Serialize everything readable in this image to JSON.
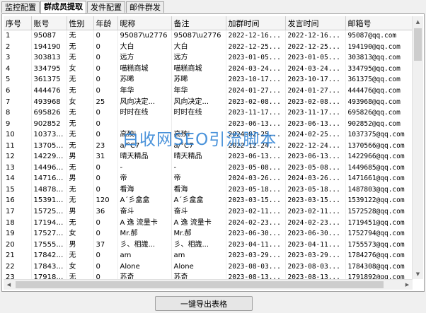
{
  "tabs": [
    "监控配置",
    "群成员提取",
    "发件配置",
    "邮件群发"
  ],
  "active_tab": 1,
  "columns": [
    "序号",
    "账号",
    "性别",
    "年龄",
    "昵称",
    "备注",
    "加群时间",
    "发言时间",
    "邮箱号"
  ],
  "rows": [
    [
      "1",
      "95087",
      "无",
      "0",
      "95087\\u2776",
      "95087\\u2776",
      "2022-12-16...",
      "2022-12-16...",
      "95087@qq.com"
    ],
    [
      "2",
      "194190",
      "无",
      "0",
      "大白",
      "大白",
      "2022-12-25...",
      "2022-12-25...",
      "194190@qq.com"
    ],
    [
      "3",
      "303813",
      "无",
      "0",
      "远方",
      "远方",
      "2023-01-05...",
      "2023-01-05...",
      "303813@qq.com"
    ],
    [
      "4",
      "334795",
      "女",
      "0",
      "喵糕商城",
      "喵糕商城",
      "2024-03-24...",
      "2024-03-24...",
      "334795@qq.com"
    ],
    [
      "5",
      "361375",
      "无",
      "0",
      "苏晞",
      "苏晞",
      "2023-10-17...",
      "2023-10-17...",
      "361375@qq.com"
    ],
    [
      "6",
      "444476",
      "无",
      "0",
      "年华",
      "年华",
      "2024-01-27...",
      "2024-01-27...",
      "444476@qq.com"
    ],
    [
      "7",
      "493968",
      "女",
      "25",
      "风向决定...",
      "风向决定...",
      "2023-02-08...",
      "2023-02-08...",
      "493968@qq.com"
    ],
    [
      "8",
      "695826",
      "无",
      "0",
      "时时在线",
      "时时在线",
      "2023-11-17...",
      "2023-11-17...",
      "695826@qq.com"
    ],
    [
      "9",
      "902852",
      "无",
      "0",
      "",
      "",
      "2023-06-13...",
      "2023-06-13...",
      "902852@qq.com"
    ],
    [
      "10",
      "1037375",
      "无",
      "0",
      "高殃i",
      "高殃i",
      "2024-02-25...",
      "2024-02-25...",
      "1037375@qq.com"
    ],
    [
      "11",
      "1370566",
      "无",
      "23",
      "a/°C7",
      "a/°C7",
      "2022-12-24...",
      "2022-12-24...",
      "1370566@qq.com"
    ],
    [
      "12",
      "1422966",
      "男",
      "31",
      "晴天精品",
      "晴天精品",
      "2023-06-13...",
      "2023-06-13...",
      "1422966@qq.com"
    ],
    [
      "13",
      "1449685",
      "无",
      "0",
      "-",
      "-",
      "2023-05-08...",
      "2023-05-08...",
      "1449685@qq.com"
    ],
    [
      "14",
      "1471661",
      "男",
      "0",
      "帝",
      "帝",
      "2024-03-26...",
      "2024-03-26...",
      "1471661@qq.com"
    ],
    [
      "15",
      "1487803",
      "无",
      "0",
      "看海",
      "看海",
      "2023-05-18...",
      "2023-05-18...",
      "1487803@qq.com"
    ],
    [
      "16",
      "1539122",
      "无",
      "120",
      "A´彡盒盒",
      "A´彡盒盒",
      "2023-03-15...",
      "2023-03-15...",
      "1539122@qq.com"
    ],
    [
      "17",
      "1572528",
      "男",
      "36",
      "奋斗",
      "奋斗",
      "2023-02-11...",
      "2023-02-11...",
      "1572528@qq.com"
    ],
    [
      "18",
      "1719451",
      "无",
      "0",
      "A 逸 流量卡",
      "A 逸 流量卡",
      "2024-02-23...",
      "2024-02-23...",
      "1719451@qq.com"
    ],
    [
      "19",
      "1752794",
      "女",
      "0",
      "Mr.郝",
      "Mr.郝",
      "2023-06-30...",
      "2023-06-30...",
      "1752794@qq.com"
    ],
    [
      "20",
      "1755573",
      "男",
      "37",
      "彡、相識...",
      "彡、相識...",
      "2023-04-11...",
      "2023-04-11...",
      "1755573@qq.com"
    ],
    [
      "21",
      "1784276",
      "无",
      "0",
      "am",
      "am",
      "2023-03-29...",
      "2023-03-29...",
      "1784276@qq.com"
    ],
    [
      "22",
      "1784308",
      "女",
      "0",
      "Alone",
      "Alone",
      "2023-08-03...",
      "2023-08-03...",
      "1784308@qq.com"
    ],
    [
      "23",
      "1791892",
      "无",
      "0",
      "苏奇",
      "苏奇",
      "2023-08-13...",
      "2023-08-13...",
      "1791892@qq.com"
    ]
  ],
  "watermark": "白收网SEO引流脚本",
  "export_button": "一键导出表格"
}
